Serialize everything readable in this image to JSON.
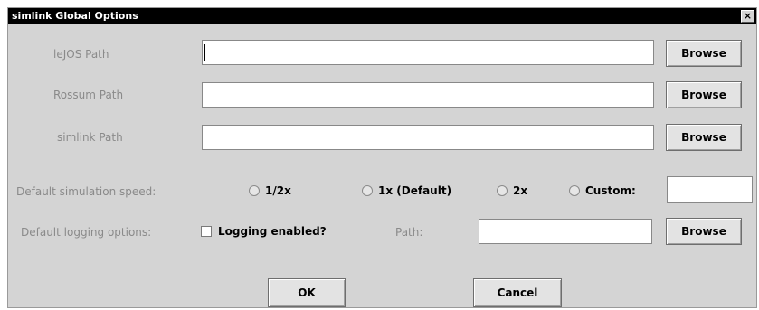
{
  "window": {
    "title": "simlink Global Options",
    "close_label": "×"
  },
  "paths": [
    {
      "label": "leJOS Path",
      "value": "",
      "browse": "Browse"
    },
    {
      "label": "Rossum Path",
      "value": "",
      "browse": "Browse"
    },
    {
      "label": "simlink Path",
      "value": "",
      "browse": "Browse"
    }
  ],
  "speed": {
    "label": "Default simulation speed:",
    "options": [
      "1/2x",
      "1x (Default)",
      "2x",
      "Custom:"
    ],
    "custom_value": ""
  },
  "logging": {
    "label": "Default logging options:",
    "checkbox_label": "Logging enabled?",
    "path_label": "Path:",
    "path_value": "",
    "browse": "Browse"
  },
  "actions": {
    "ok": "OK",
    "cancel": "Cancel"
  }
}
